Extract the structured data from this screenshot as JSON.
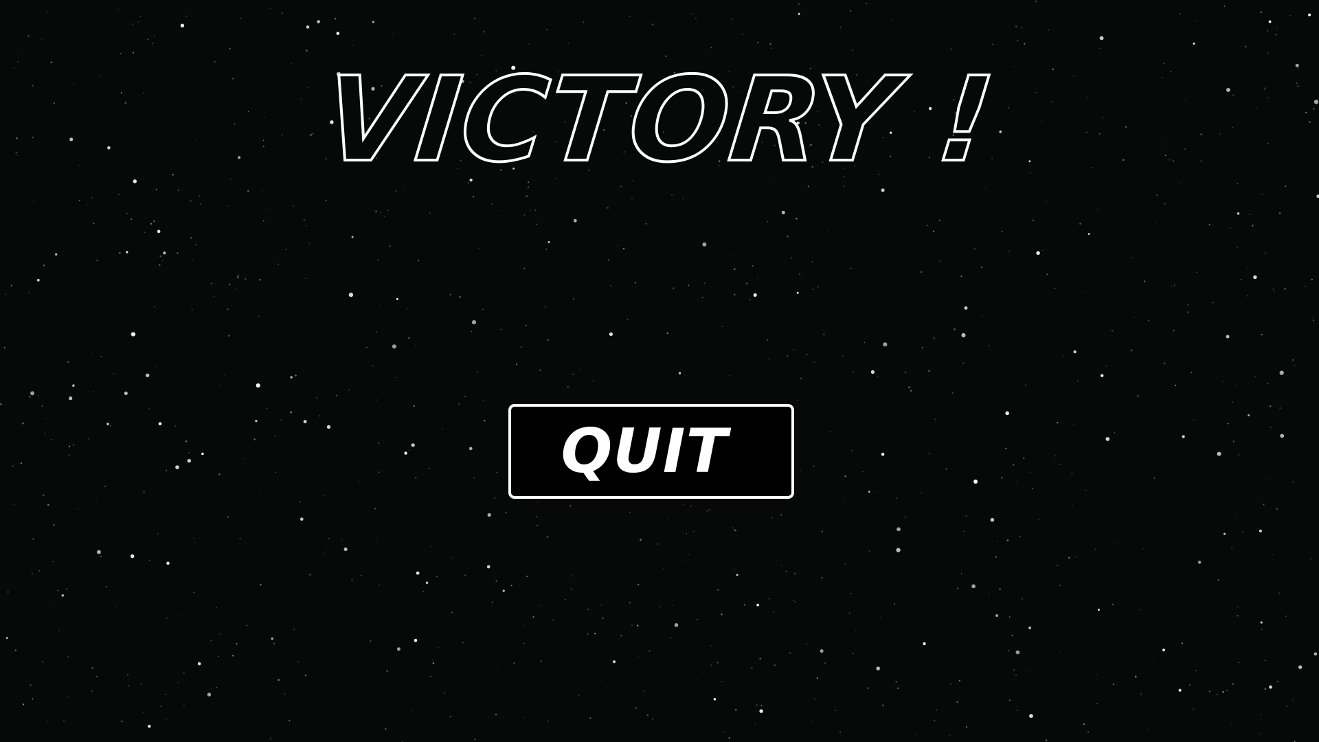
{
  "screen": {
    "title": "VICTORY !",
    "quit_label": "QUIT"
  },
  "background": {
    "color": "#070909",
    "star_color": "#ffffff",
    "icon": "starfield"
  }
}
